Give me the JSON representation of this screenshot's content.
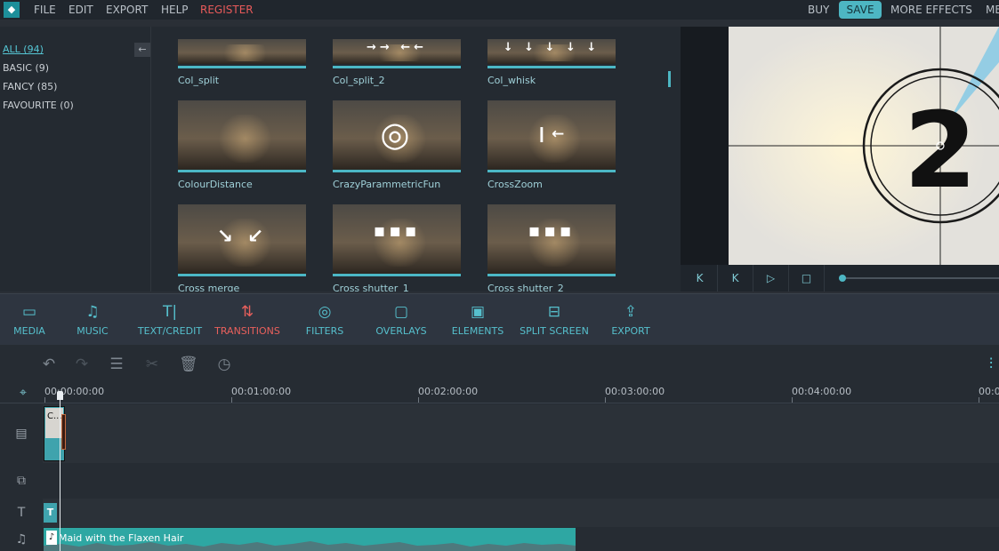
{
  "menu": {
    "file": "FILE",
    "edit": "EDIT",
    "export": "EXPORT",
    "help": "HELP",
    "register": "REGISTER",
    "buy": "BUY",
    "save": "SAVE",
    "more_effects": "MORE EFFECTS",
    "truncated": "ME"
  },
  "library": {
    "categories": [
      {
        "label": "ALL (94)",
        "active": true
      },
      {
        "label": "BASIC (9)",
        "active": false
      },
      {
        "label": "FANCY (85)",
        "active": false
      },
      {
        "label": "FAVOURITE (0)",
        "active": false
      }
    ],
    "collapse_glyph": "←",
    "transitions": [
      {
        "name": "Col_split",
        "glyph": ""
      },
      {
        "name": "Col_split_2",
        "glyph": "→→ ←←"
      },
      {
        "name": "Col_whisk",
        "glyph": "↓ ↓ ↓ ↓ ↓"
      },
      {
        "name": "ColourDistance",
        "glyph": ""
      },
      {
        "name": "CrazyParammetricFun",
        "glyph": "◎"
      },
      {
        "name": "CrossZoom",
        "glyph": "❙←"
      },
      {
        "name": "Cross merge",
        "glyph": "↘ ↙"
      },
      {
        "name": "Cross shutter_1",
        "glyph": "▪▪▪"
      },
      {
        "name": "Cross shutter_2",
        "glyph": "▪▪▪"
      }
    ]
  },
  "preview": {
    "countdown": "2",
    "buttons": [
      "K",
      "K",
      "▷",
      "□"
    ]
  },
  "toolbar": {
    "items": [
      {
        "label": "MEDIA",
        "icon": "folder-icon",
        "glyph": "▭",
        "active": false
      },
      {
        "label": "MUSIC",
        "icon": "music-note-icon",
        "glyph": "♫",
        "active": false
      },
      {
        "label": "TEXT/CREDIT",
        "icon": "text-icon",
        "glyph": "T|",
        "active": false
      },
      {
        "label": "TRANSITIONS",
        "icon": "transitions-icon",
        "glyph": "⇅",
        "active": true
      },
      {
        "label": "FILTERS",
        "icon": "filters-icon",
        "glyph": "◎",
        "active": false
      },
      {
        "label": "OVERLAYS",
        "icon": "overlays-icon",
        "glyph": "▢",
        "active": false
      },
      {
        "label": "ELEMENTS",
        "icon": "image-icon",
        "glyph": "▣",
        "active": false
      },
      {
        "label": "SPLIT SCREEN",
        "icon": "split-screen-icon",
        "glyph": "⊟",
        "active": false
      },
      {
        "label": "EXPORT",
        "icon": "export-icon",
        "glyph": "⇪",
        "active": false
      }
    ]
  },
  "timeline": {
    "ruler": [
      "00:00:00:00",
      "00:01:00:00",
      "00:02:00:00",
      "00:03:00:00",
      "00:04:00:00",
      "00:0"
    ],
    "video_clip_label": "C...",
    "text_clip_label": "T",
    "audio_clip_label": "Maid with the Flaxen Hair"
  },
  "colors": {
    "accent": "#4db6c3",
    "active_tool": "#e8605c",
    "register": "#e85a5a"
  }
}
